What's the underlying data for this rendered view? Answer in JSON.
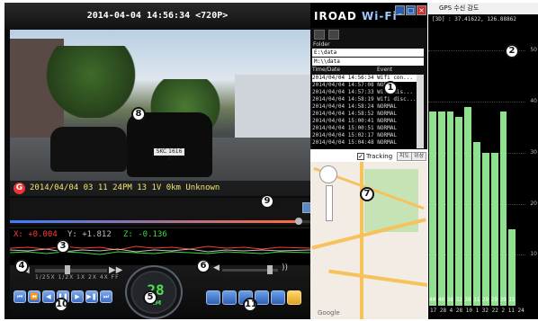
{
  "player": {
    "title": "2014-04-04 14:56:34 <720P>",
    "video_overlay": "2014/04/04 03 11 24PM 13 1V  0km Unknown",
    "plate": "SKC 1616 X",
    "seek_progress": 0.96,
    "g_logo": "G"
  },
  "graph": {
    "x_label": "X: +0.004",
    "y_label": "Y: +1.812",
    "z_label": "Z: -0.136"
  },
  "controls": {
    "speed_ticks": "1/25X  1/2X 1X  2X  4X  FF",
    "speedometer_value": "28",
    "speedometer_unit": "KM",
    "volume": 0.85,
    "speed_position": 0.45
  },
  "wifi": {
    "app_title_a": "IROAD",
    "app_title_b": "Wi-Fi",
    "folder_label": "Folder",
    "folder_1": "E:\\data",
    "folder_2": "M:\\\\data",
    "col_time": "Time/Date",
    "col_event": "Event",
    "rows": [
      {
        "time": "2014/04/04 14:56:34",
        "event": "Wifi con..."
      },
      {
        "time": "2014/04/04 14:57:08",
        "event": "NORMAL"
      },
      {
        "time": "2014/04/04 14:57:33",
        "event": "Wifi dis..."
      },
      {
        "time": "2014/04/04 14:58:19",
        "event": "Wifi disc..."
      },
      {
        "time": "2014/04/04 14:58:24",
        "event": "NORMAL"
      },
      {
        "time": "2014/04/04 14:58:52",
        "event": "NORMAL"
      },
      {
        "time": "2014/04/04 15:00:41",
        "event": "NORMAL"
      },
      {
        "time": "2014/04/04 15:00:51",
        "event": "NORMAL"
      },
      {
        "time": "2014/04/04 15:02:17",
        "event": "NORMAL"
      },
      {
        "time": "2014/04/04 15:04:48",
        "event": "NORMAL"
      }
    ]
  },
  "map": {
    "tracking_label": "Tracking",
    "btn_a": "지도",
    "btn_b": "위성",
    "google": "Google"
  },
  "gps": {
    "title": "GPS 수신 감도",
    "coord": "[3D] : 37.41622, 126.88862",
    "bottom_ids": "17 28  4  28  10  1  32  22  2  11  24",
    "y_ticks": [
      "50",
      "40",
      "30",
      "20",
      "10"
    ],
    "bars": [
      {
        "snr": "40",
        "value": 38
      },
      {
        "snr": "40",
        "value": 38
      },
      {
        "snr": "38",
        "value": 38
      },
      {
        "snr": "32",
        "value": 37
      },
      {
        "snr": "39",
        "value": 39
      },
      {
        "snr": "31",
        "value": 32
      },
      {
        "snr": "29",
        "value": 30
      },
      {
        "snr": "29",
        "value": 30
      },
      {
        "snr": "39",
        "value": 38
      },
      {
        "snr": "15",
        "value": 15
      },
      {
        "snr": "",
        "value": 0
      }
    ],
    "y_max": 55
  },
  "markers": [
    "1",
    "2",
    "3",
    "4",
    "5",
    "6",
    "7",
    "8",
    "9",
    "10",
    "11"
  ],
  "colors": {
    "gps_bar": "#8fe08f",
    "accent": "#3d6fc6",
    "speedo": "#49e24f"
  },
  "chart_data": {
    "type": "bar",
    "title": "GPS 수신 감도",
    "categories": [
      "17",
      "28",
      "4",
      "28",
      "10",
      "1",
      "32",
      "22",
      "2",
      "11",
      "24"
    ],
    "values": [
      38,
      38,
      38,
      37,
      39,
      32,
      30,
      30,
      38,
      15,
      0
    ],
    "ylim": [
      0,
      55
    ],
    "bar_labels": [
      "40",
      "40",
      "38",
      "32",
      "39",
      "31",
      "29",
      "29",
      "39",
      "15",
      ""
    ]
  }
}
